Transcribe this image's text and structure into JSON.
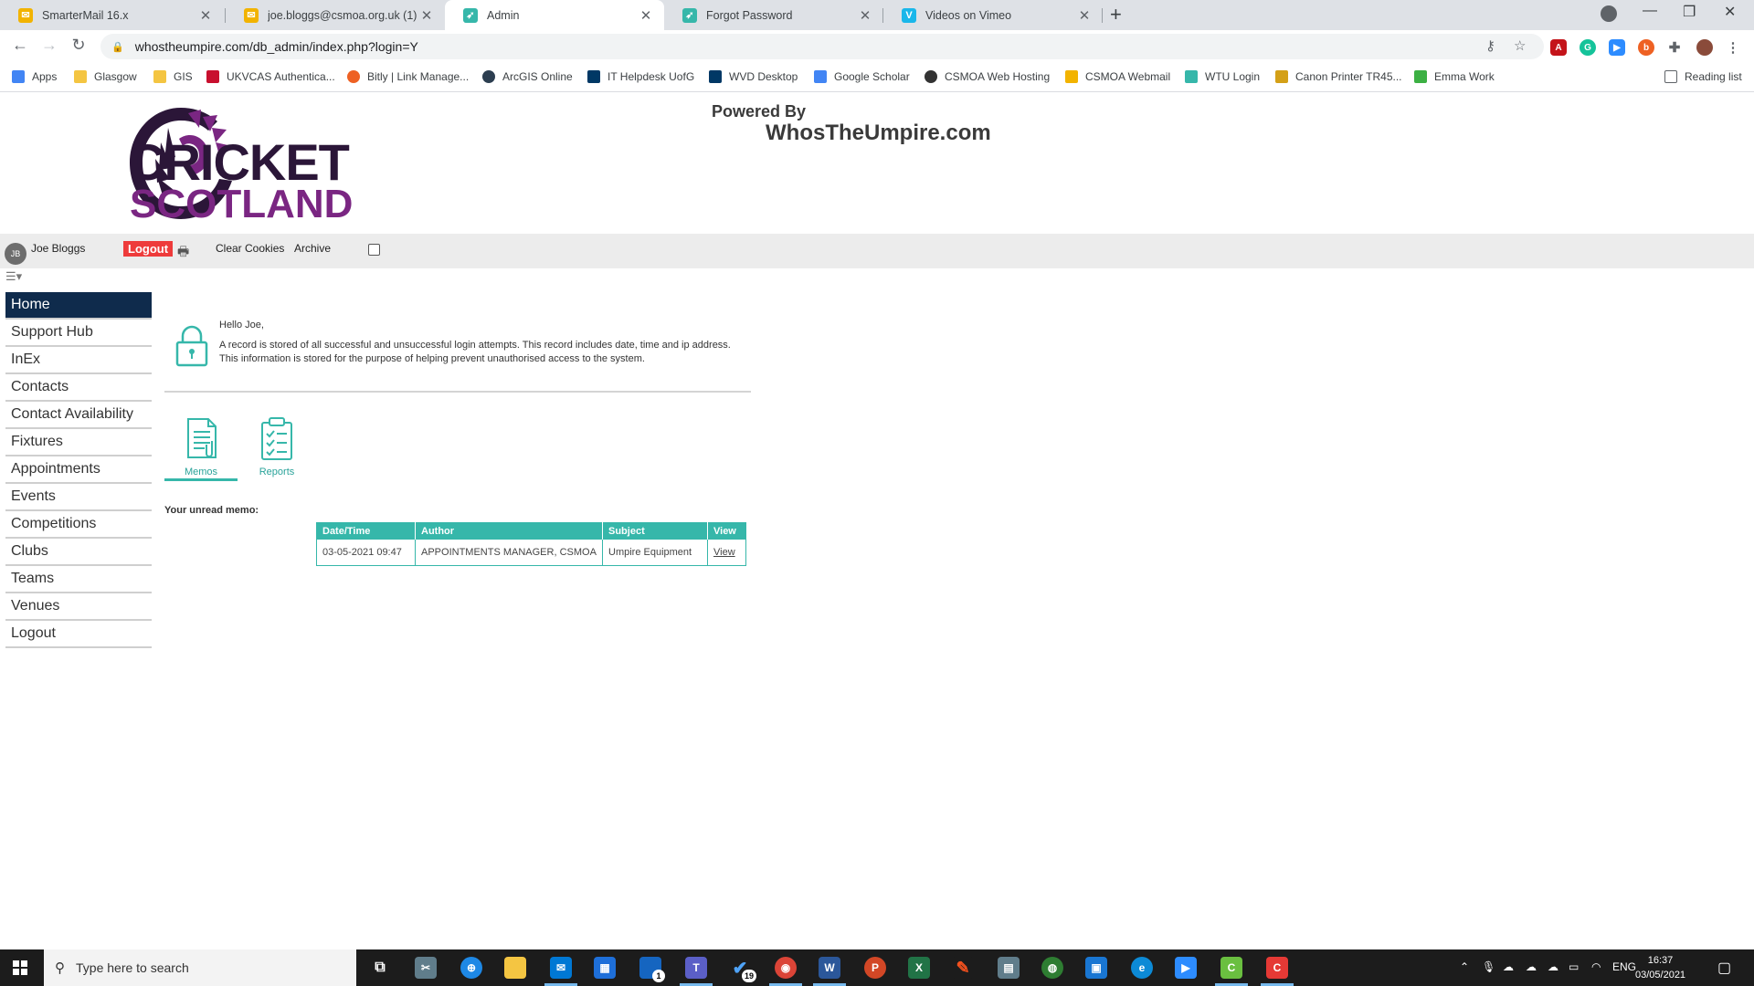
{
  "browser": {
    "tabs": [
      {
        "title": "SmarterMail 16.x",
        "icon": "mail-icon",
        "color": "#f2b300"
      },
      {
        "title": "joe.bloggs@csmoa.org.uk (1)",
        "icon": "mail-icon",
        "color": "#f2b300"
      },
      {
        "title": "Admin",
        "icon": "wtu-bird-icon",
        "color": "#36b7aa"
      },
      {
        "title": "Forgot Password",
        "icon": "wtu-bird-icon",
        "color": "#36b7aa"
      },
      {
        "title": "Videos on Vimeo",
        "icon": "vimeo-icon",
        "color": "#1ab7ea"
      }
    ],
    "url": "whostheumpire.com/db_admin/index.php?login=Y",
    "bookmarks": [
      {
        "label": "Apps",
        "icon": "apps-grid-icon",
        "color": "#4285f4"
      },
      {
        "label": "Glasgow",
        "icon": "folder-icon",
        "color": "#f4c542"
      },
      {
        "label": "GIS",
        "icon": "folder-icon",
        "color": "#f4c542"
      },
      {
        "label": "UKVCAS Authentica...",
        "icon": "ukvcas-icon",
        "color": "#c8102e"
      },
      {
        "label": "Bitly | Link Manage...",
        "icon": "bitly-icon",
        "color": "#ee6123"
      },
      {
        "label": "ArcGIS Online",
        "icon": "globe-icon",
        "color": "#2c3e50"
      },
      {
        "label": "IT Helpdesk UofG",
        "icon": "uofg-crest-icon",
        "color": "#003865"
      },
      {
        "label": "WVD Desktop",
        "icon": "uofg-crest-icon",
        "color": "#003865"
      },
      {
        "label": "Google Scholar",
        "icon": "scholar-icon",
        "color": "#4285f4"
      },
      {
        "label": "CSMOA Web Hosting",
        "icon": "p-circle-icon",
        "color": "#333333"
      },
      {
        "label": "CSMOA Webmail",
        "icon": "mail-icon",
        "color": "#f2b300"
      },
      {
        "label": "WTU Login",
        "icon": "wtu-bird-icon",
        "color": "#36b7aa"
      },
      {
        "label": "Canon Printer TR45...",
        "icon": "canon-icon",
        "color": "#d4a017"
      },
      {
        "label": "Emma Work",
        "icon": "emma-icon",
        "color": "#3cb043"
      }
    ],
    "reading_list": "Reading list"
  },
  "header": {
    "logo_line1": "CRICKET",
    "logo_line2": "SCOTLAND",
    "powered_by": "Powered By",
    "brand": "WhosTheUmpire.com"
  },
  "userbar": {
    "initials": "JB",
    "name": "Joe Bloggs",
    "logout": "Logout",
    "clear_cookies": "Clear Cookies",
    "archive": "Archive"
  },
  "sidebar": {
    "items": [
      {
        "label": "Home",
        "active": true
      },
      {
        "label": "Support Hub"
      },
      {
        "label": "InEx"
      },
      {
        "label": "Contacts"
      },
      {
        "label": "Contact Availability"
      },
      {
        "label": "Fixtures"
      },
      {
        "label": "Appointments"
      },
      {
        "label": "Events"
      },
      {
        "label": "Competitions"
      },
      {
        "label": "Clubs"
      },
      {
        "label": "Teams"
      },
      {
        "label": "Venues"
      },
      {
        "label": "Logout"
      }
    ]
  },
  "main": {
    "greeting": "Hello Joe,",
    "notice": "A record is stored of all successful and unsuccessful login attempts. This record includes date, time and ip address. This information is stored for the purpose of helping prevent unauthorised access to the system.",
    "tiles": [
      {
        "label": "Memos",
        "selected": true
      },
      {
        "label": "Reports"
      }
    ],
    "unread_heading": "Your unread memo:",
    "memo_table": {
      "headers": [
        "Date/Time",
        "Author",
        "Subject",
        "View"
      ],
      "rows": [
        [
          "03-05-2021 09:47",
          "APPOINTMENTS MANAGER, CSMOA",
          "Umpire Equipment",
          "View"
        ]
      ]
    },
    "accent_color": "#36b7aa"
  },
  "taskbar": {
    "search_placeholder": "Type here to search",
    "language": "ENG",
    "time": "16:37",
    "date": "03/05/2021",
    "badges": {
      "badge_a": "1",
      "badge_b": "19"
    }
  }
}
